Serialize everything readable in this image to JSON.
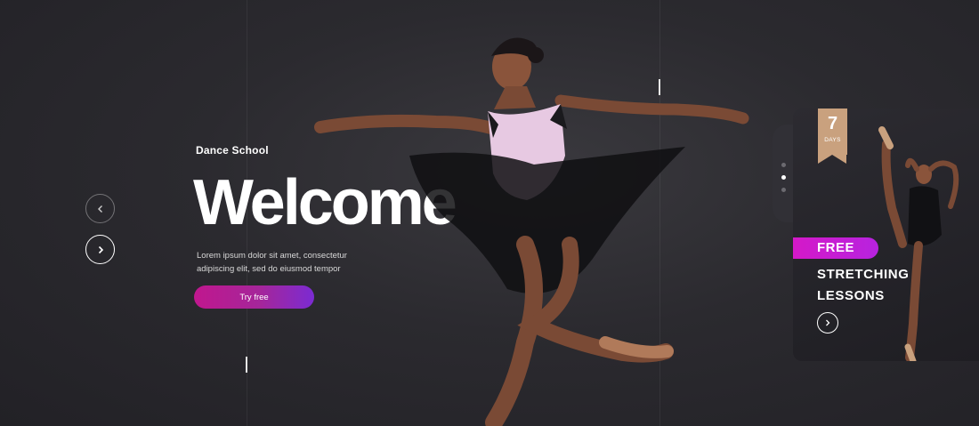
{
  "hero": {
    "eyebrow": "Dance School",
    "title": "Welcome",
    "description": "Lorem ipsum dolor sit amet, consectetur adipiscing elit, sed do eiusmod tempor",
    "cta_label": "Try free"
  },
  "slider": {
    "prev_icon": "chevron-left-icon",
    "next_icon": "chevron-right-icon",
    "dot_count": 3,
    "active_dot": 2
  },
  "promo": {
    "days_number": "7",
    "days_label": "DAYS",
    "badge": "FREE",
    "line1": "STRETCHING",
    "line2": "LESSONS",
    "button_icon": "chevron-right-icon"
  },
  "colors": {
    "accent_start": "#c0178e",
    "accent_end": "#7b2bd2",
    "free_badge": "#d419c8",
    "days_badge": "#c9a17e",
    "background": "#2b2a2f"
  }
}
